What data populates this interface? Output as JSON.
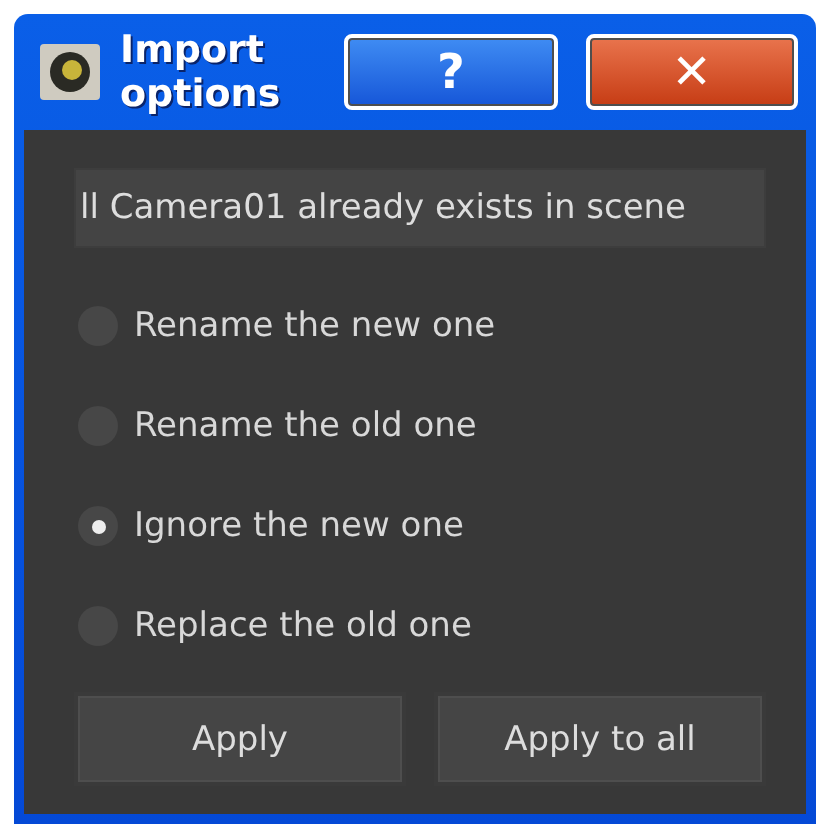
{
  "window": {
    "title": "Import options",
    "buttons": [
      {
        "kind": "help",
        "label": "?"
      },
      {
        "kind": "close",
        "label": "✕"
      }
    ]
  },
  "message": "ll Camera01 already exists in scene",
  "options": [
    {
      "label": "Rename the new one",
      "selected": false
    },
    {
      "label": "Rename the old one",
      "selected": false
    },
    {
      "label": "Ignore the new one",
      "selected": true
    },
    {
      "label": "Replace the old one",
      "selected": false
    }
  ],
  "buttons": [
    "Apply",
    "Apply to all"
  ]
}
